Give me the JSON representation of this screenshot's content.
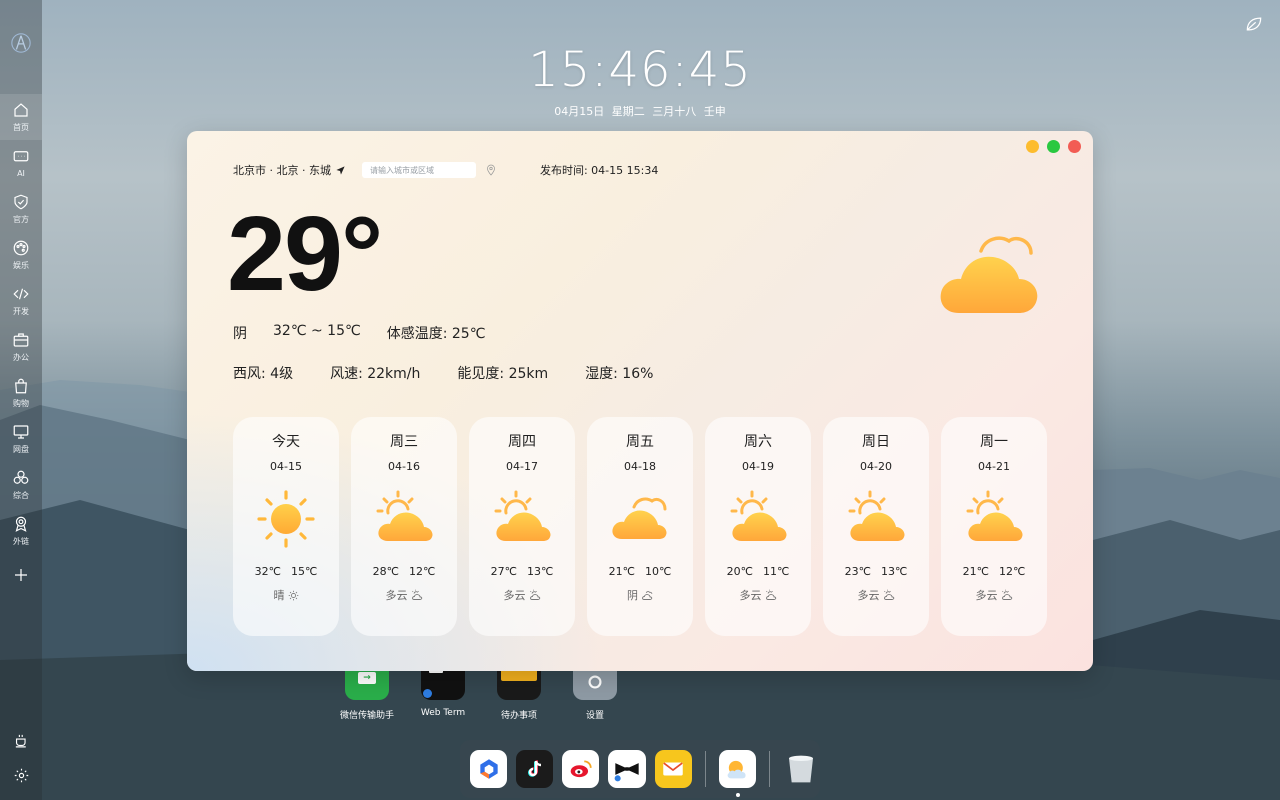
{
  "sidebar": {
    "items": [
      {
        "label": "首页",
        "icon": "home-icon"
      },
      {
        "label": "AI",
        "icon": "chat-icon"
      },
      {
        "label": "官方",
        "icon": "shield-check-icon"
      },
      {
        "label": "娱乐",
        "icon": "palette-icon"
      },
      {
        "label": "开发",
        "icon": "code-icon"
      },
      {
        "label": "办公",
        "icon": "briefcase-icon"
      },
      {
        "label": "购物",
        "icon": "shopping-bag-icon"
      },
      {
        "label": "网盘",
        "icon": "monitor-icon"
      },
      {
        "label": "综合",
        "icon": "circles-icon"
      },
      {
        "label": "外链",
        "icon": "award-icon"
      }
    ]
  },
  "clock": {
    "time": "15:46:45",
    "date": "04月15日 星期二 三月十八 壬申"
  },
  "weather": {
    "location": "北京市 · 北京 · 东城",
    "search_placeholder": "请输入城市或区域",
    "publish_time": "发布时间: 04-15 15:34",
    "current_temp": "29°",
    "condition": "阴",
    "range": "32℃ ~ 15℃",
    "feels_like": "体感温度: 25℃",
    "wind_dir": "西风: 4级",
    "wind_speed": "风速: 22km/h",
    "visibility": "能见度: 25km",
    "humidity": "湿度: 16%",
    "forecast": [
      {
        "day": "今天",
        "date": "04-15",
        "high": "32℃",
        "low": "15℃",
        "cond": "晴",
        "icon": "sun-icon"
      },
      {
        "day": "周三",
        "date": "04-16",
        "high": "28℃",
        "low": "12℃",
        "cond": "多云",
        "icon": "partly-cloudy-icon"
      },
      {
        "day": "周四",
        "date": "04-17",
        "high": "27℃",
        "low": "13℃",
        "cond": "多云",
        "icon": "partly-cloudy-icon"
      },
      {
        "day": "周五",
        "date": "04-18",
        "high": "21℃",
        "low": "10℃",
        "cond": "阴",
        "icon": "cloudy-icon"
      },
      {
        "day": "周六",
        "date": "04-19",
        "high": "20℃",
        "low": "11℃",
        "cond": "多云",
        "icon": "partly-cloudy-icon"
      },
      {
        "day": "周日",
        "date": "04-20",
        "high": "23℃",
        "low": "13℃",
        "cond": "多云",
        "icon": "partly-cloudy-icon"
      },
      {
        "day": "周一",
        "date": "04-21",
        "high": "21℃",
        "low": "12℃",
        "cond": "多云",
        "icon": "partly-cloudy-icon"
      }
    ]
  },
  "desktop_icons": [
    {
      "name": "微信传输助手",
      "color": "#2aae4a"
    },
    {
      "name": "Web Term",
      "color": "#111111"
    },
    {
      "name": "待办事项",
      "color": "#1a1a1a"
    },
    {
      "name": "设置",
      "color": "#8e9aa4"
    }
  ],
  "dock": {
    "apps": [
      "app-store-icon",
      "tiktok-icon",
      "weibo-icon",
      "bowtie-icon",
      "mail-icon",
      "weather-app-icon",
      "trash-icon"
    ]
  },
  "colors": {
    "accent_orange": "#ffb030",
    "win_close": "#f25c54",
    "win_min": "#fdbc2e",
    "win_max": "#2ac840"
  }
}
